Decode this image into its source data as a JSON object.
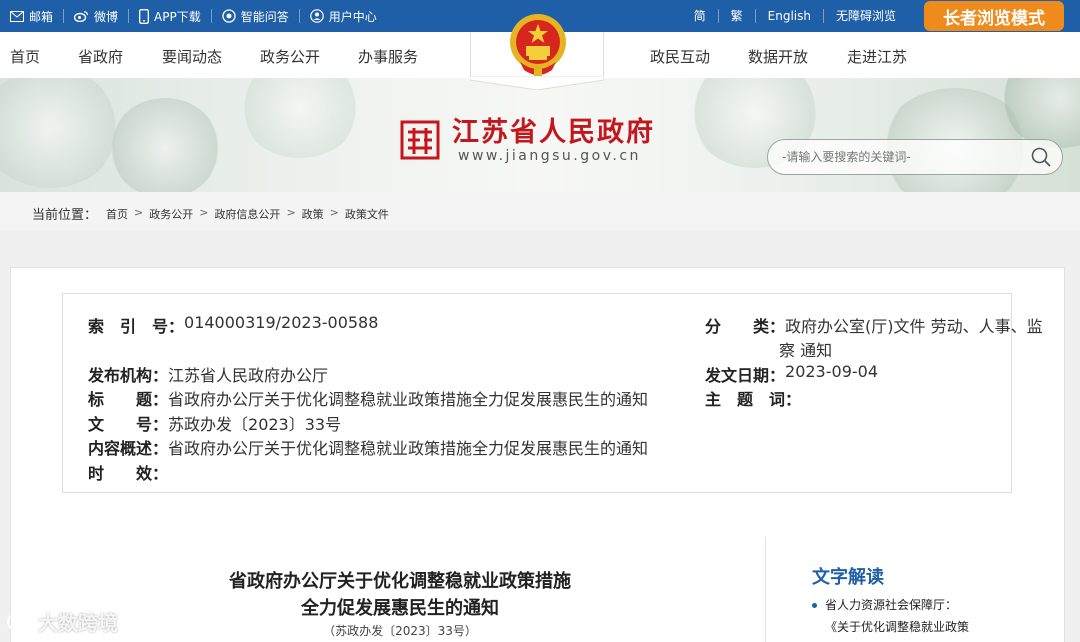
{
  "topbar": {
    "links": [
      {
        "label": "邮箱",
        "icon": "mail-icon"
      },
      {
        "label": "微博",
        "icon": "weibo-icon"
      },
      {
        "label": "APP下载",
        "icon": "mobile-icon"
      },
      {
        "label": "智能问答",
        "icon": "qa-icon"
      },
      {
        "label": "用户中心",
        "icon": "user-icon"
      }
    ],
    "lang": [
      "简",
      "繁",
      "English",
      "无障碍浏览"
    ],
    "elder_mode": "长者浏览模式",
    "bg": "#1f5fa8",
    "accent": "#ef8a1c"
  },
  "nav": {
    "left": [
      "首页",
      "省政府",
      "要闻动态",
      "政务公开",
      "办事服务"
    ],
    "right": [
      "政民互动",
      "数据开放",
      "走进江苏"
    ]
  },
  "banner": {
    "title": "江苏省人民政府",
    "url": "www.jiangsu.gov.cn",
    "search_placeholder": "-请输入要搜索的关键词-",
    "title_color": "#c4161c"
  },
  "breadcrumb": {
    "label": "当前位置：",
    "items": [
      "首页",
      "政务公开",
      "政府信息公开",
      "政策",
      "政策文件"
    ]
  },
  "meta": {
    "index_key": "索　引　号：",
    "index_val": "014000319/2023-00588",
    "category_key": "分　　类：",
    "category_val_1": "政府办公室(厅)文件 劳动、人事、监",
    "category_val_2": "察 通知",
    "org_key": "发布机构：",
    "org_val": "江苏省人民政府办公厅",
    "date_key": "发文日期：",
    "date_val": "2023-09-04",
    "title_key": "标　　题：",
    "title_val": "省政府办公厅关于优化调整稳就业政策措施全力促发展惠民生的通知",
    "subject_key": "主　题　词：",
    "subject_val": "",
    "docno_key": "文　　号：",
    "docno_val": "苏政办发〔2023〕33号",
    "summary_key": "内容概述：",
    "summary_val": "省政府办公厅关于优化调整稳就业政策措施全力促发展惠民生的通知",
    "validity_key": "时　　效：",
    "validity_val": ""
  },
  "document": {
    "title_line1": "省政府办公厅关于优化调整稳就业政策措施",
    "title_line2": "全力促发展惠民生的通知",
    "number": "（苏政办发〔2023〕33号）"
  },
  "sidebar": {
    "title": "文字解读",
    "item_line1": "省人力资源社会保障厅：",
    "item_line2": "《关于优化调整稳就业政策"
  },
  "watermark": "大数跨境"
}
